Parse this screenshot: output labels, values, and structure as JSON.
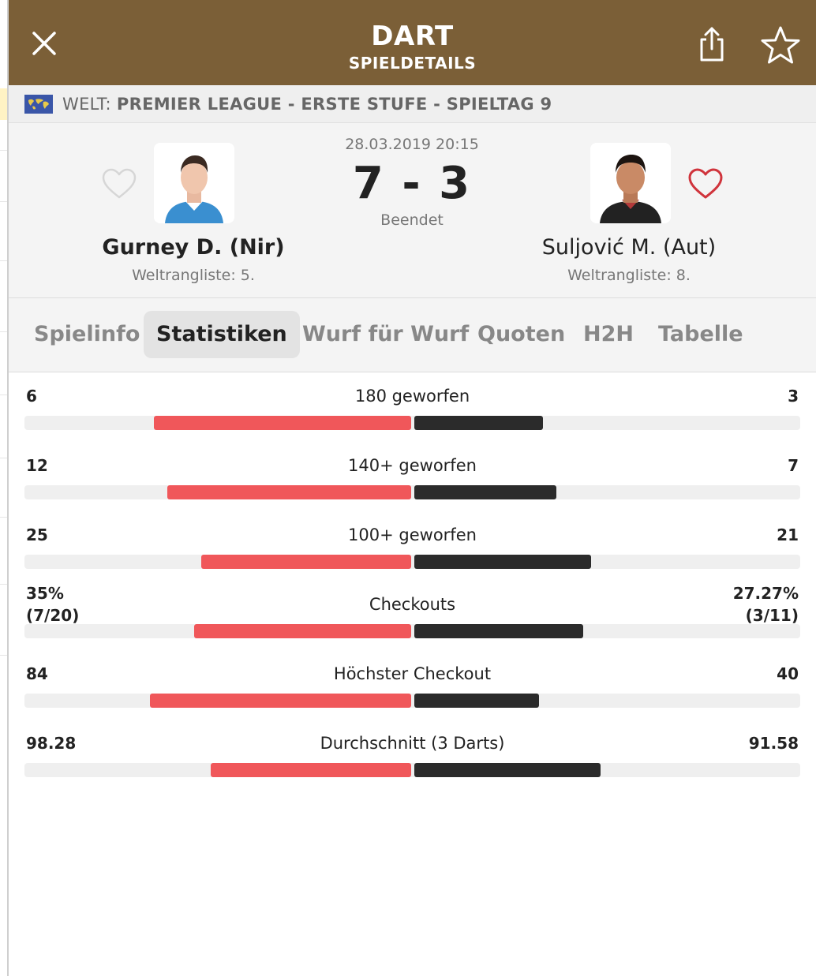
{
  "header": {
    "title": "DART",
    "subtitle": "SPIELDETAILS",
    "close_icon": "close-icon",
    "share_icon": "share-icon",
    "star_icon": "star-icon"
  },
  "league": {
    "country": "WELT:",
    "name": "PREMIER LEAGUE - ERSTE STUFE - SPIELTAG 9",
    "flag_icon": "world-flag-icon"
  },
  "match": {
    "datetime": "28.03.2019 20:15",
    "score": "7 - 3",
    "status": "Beendet",
    "home": {
      "name": "Gurney D. (Nir)",
      "rank": "Weltrangliste: 5.",
      "favorite": false
    },
    "away": {
      "name": "Suljović M. (Aut)",
      "rank": "Weltrangliste: 8.",
      "favorite": true
    }
  },
  "tabs": [
    {
      "label": "Spielinfo",
      "active": false
    },
    {
      "label": "Statistiken",
      "active": true
    },
    {
      "label": "Wurf für Wurf",
      "active": false
    },
    {
      "label": "Quoten",
      "active": false
    },
    {
      "label": "H2H",
      "active": false
    },
    {
      "label": "Tabelle",
      "active": false
    }
  ],
  "stats": [
    {
      "label": "180 geworfen",
      "left": "6",
      "left_sub": "",
      "right": "3",
      "right_sub": "",
      "left_share": 0.667,
      "right_share": 0.333
    },
    {
      "label": "140+ geworfen",
      "left": "12",
      "left_sub": "",
      "right": "7",
      "right_sub": "",
      "left_share": 0.632,
      "right_share": 0.368
    },
    {
      "label": "100+ geworfen",
      "left": "25",
      "left_sub": "",
      "right": "21",
      "right_sub": "",
      "left_share": 0.543,
      "right_share": 0.457
    },
    {
      "label": "Checkouts",
      "left": "35%",
      "left_sub": "(7/20)",
      "right": "27.27%",
      "right_sub": "(3/11)",
      "left_share": 0.562,
      "right_share": 0.438
    },
    {
      "label": "Höchster Checkout",
      "left": "84",
      "left_sub": "",
      "right": "40",
      "right_sub": "",
      "left_share": 0.677,
      "right_share": 0.323
    },
    {
      "label": "Durchschnitt (3 Darts)",
      "left": "98.28",
      "left_sub": "",
      "right": "91.58",
      "right_sub": "",
      "left_share": 0.518,
      "right_share": 0.482
    }
  ],
  "colors": {
    "header_bg": "#7b5f37",
    "home_bar": "#f0575a",
    "away_bar": "#2b2b2b",
    "fav_active": "#d0343c"
  }
}
